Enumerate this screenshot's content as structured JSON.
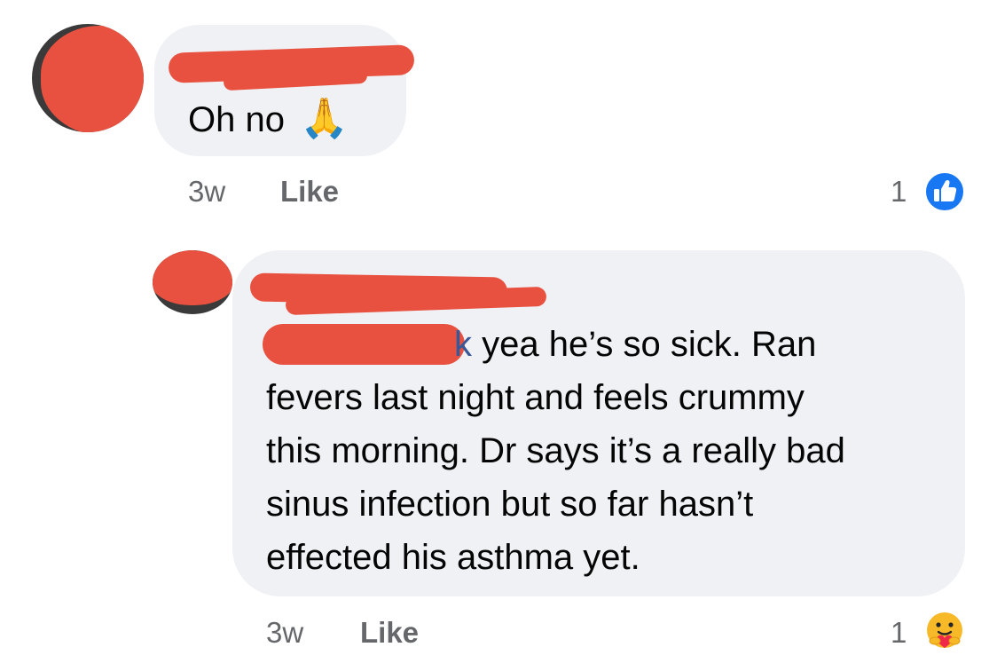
{
  "comments": [
    {
      "text": "Oh no",
      "emoji": "🙏",
      "time": "3w",
      "like_label": "Like",
      "reaction_count": "1",
      "reaction_icon": "like-thumb-icon"
    },
    {
      "tag_tail": "k",
      "text_line1": " yea he’s so sick. Ran",
      "text_line2": "fevers last night and feels crummy",
      "text_line3": "this morning. Dr says it’s a really bad",
      "text_line4": "sinus infection but so far hasn’t",
      "text_line5": "effected his asthma yet.",
      "time": "3w",
      "like_label": "Like",
      "reaction_count": "1",
      "reaction_icon": "care-hug-icon"
    }
  ],
  "colors": {
    "bubble": "#f0f1f5",
    "redaction": "#e8513f",
    "meta_text": "#65676b",
    "like_blue": "#1877f2",
    "mention_blue": "#385898"
  }
}
